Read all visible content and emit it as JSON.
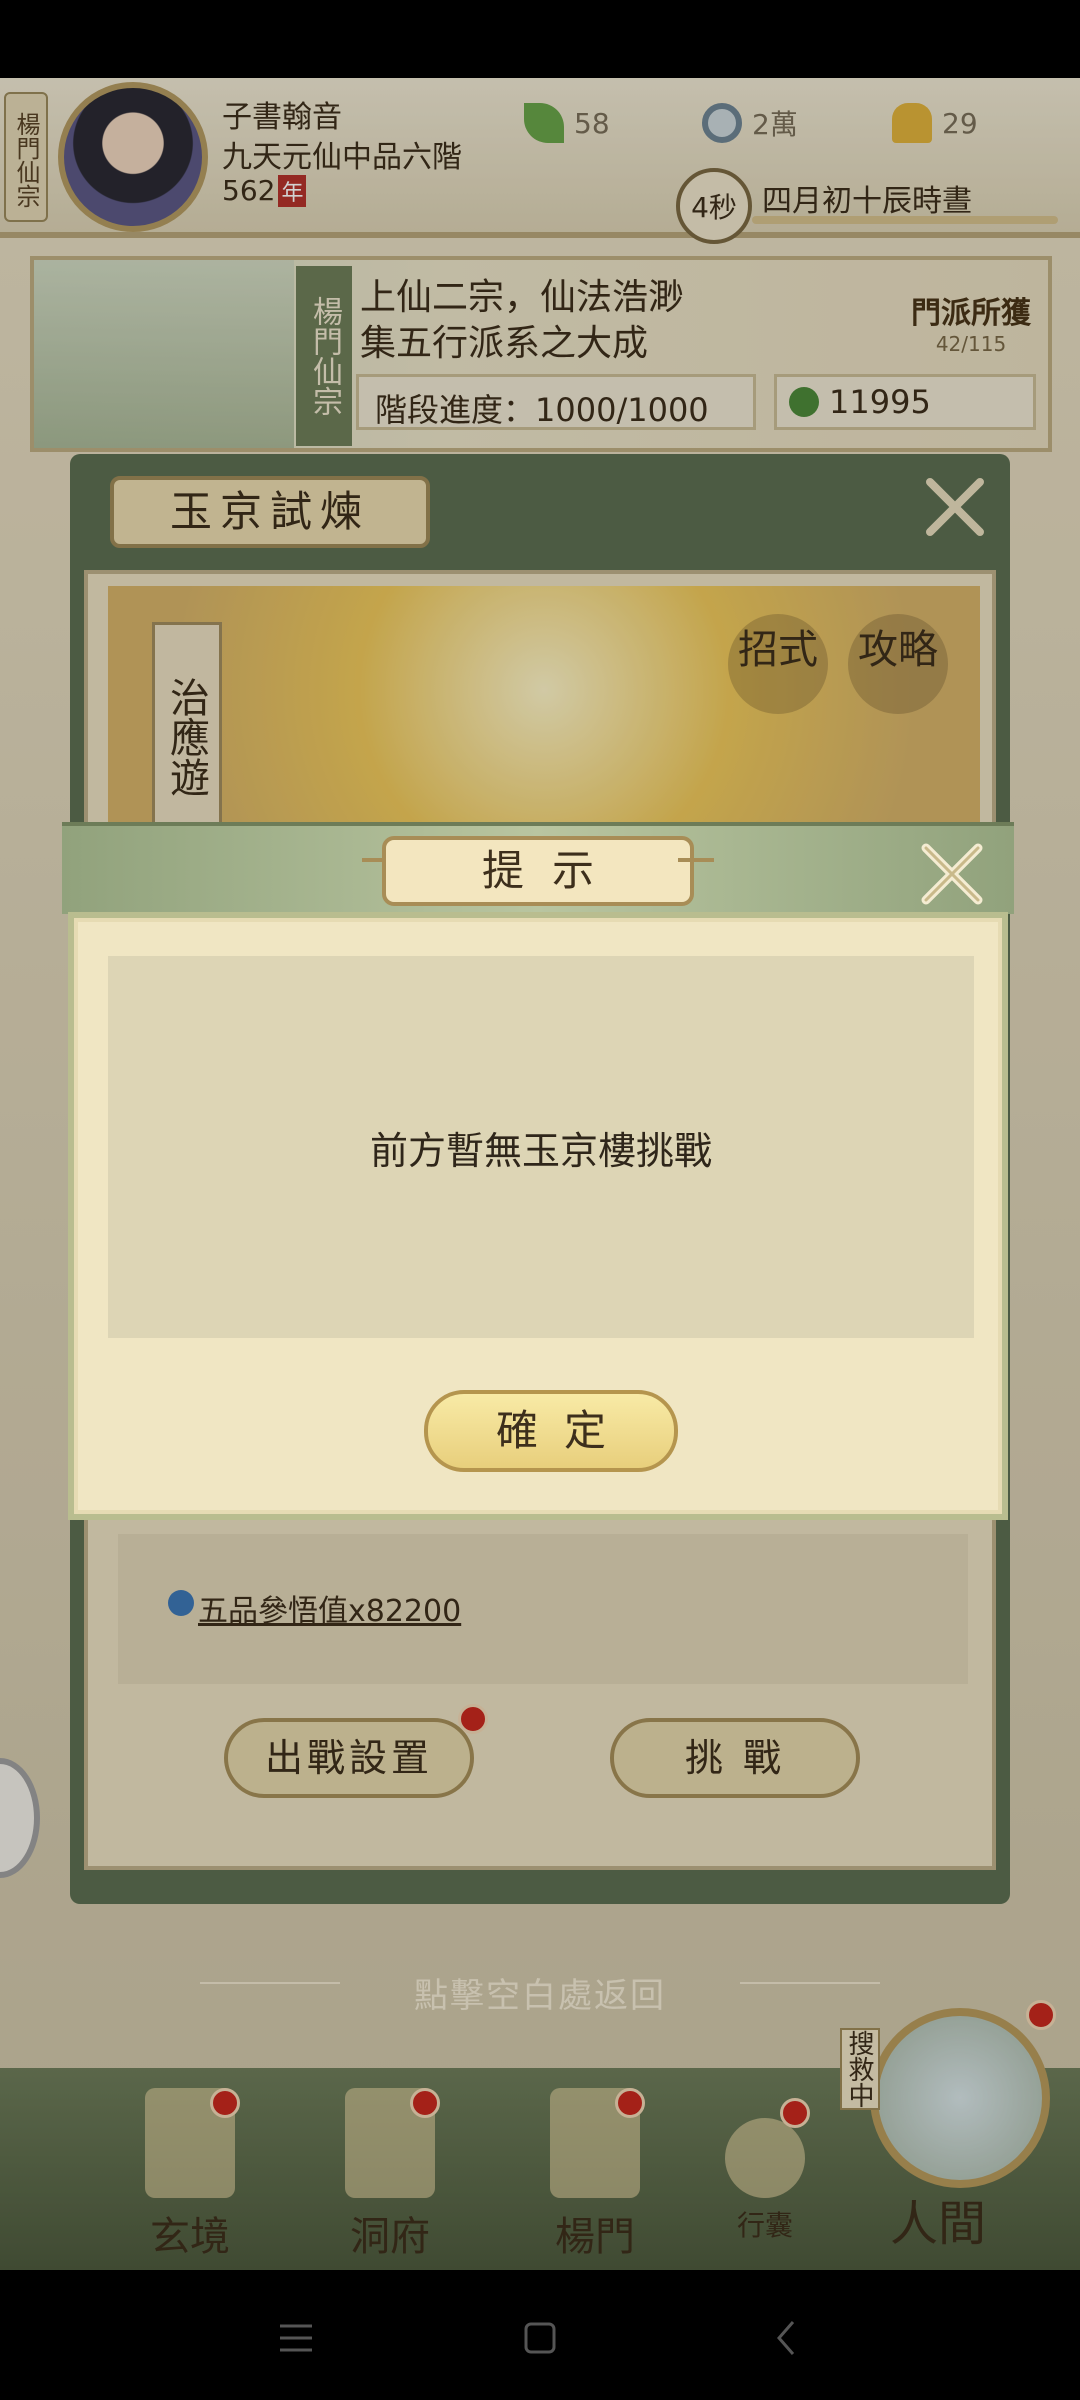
{
  "player": {
    "sect_tag": "楊門仙宗",
    "name": "子書翰音",
    "rank": "九天元仙中品六階",
    "age": "562",
    "age_unit": "年"
  },
  "resources": [
    {
      "icon": "leaf-icon",
      "value": "58"
    },
    {
      "icon": "coin-icon",
      "value": "2萬"
    },
    {
      "icon": "ingot-icon",
      "value": "29"
    }
  ],
  "timer": {
    "seconds": "4秒",
    "date": "四月初十辰時晝"
  },
  "sect_banner": {
    "sect_name": "楊門仙宗",
    "motto_line1": "上仙二宗，仙法浩渺",
    "motto_line2": "集五行派系之大成",
    "progress": "階段進度：1000/1000",
    "money": "11995",
    "gain_title": "門派所獲",
    "gain_count": "42/115"
  },
  "trial_panel": {
    "title": "玉京試煉",
    "boss_name": "治應遊",
    "moves_label": "招式",
    "guide_label": "攻略",
    "reward_text": "五品參悟值x82200",
    "battle_setup_label": "出戰設置",
    "challenge_label": "挑 戰"
  },
  "back_hint": "點擊空白處返回",
  "bottom_nav": {
    "items": [
      {
        "label": "玄境"
      },
      {
        "label": "洞府"
      },
      {
        "label": "楊門"
      },
      {
        "label": "行囊"
      }
    ],
    "searching": "搜救中",
    "world_label": "人間"
  },
  "tip_dialog": {
    "title": "提示",
    "message": "前方暫無玉京樓挑戰",
    "confirm_label": "確定"
  },
  "colors": {
    "panel_green": "#5d7052",
    "parchment": "#f0e6c3",
    "button_gold": "#e8cf7c",
    "badge_red": "#c8291e"
  }
}
